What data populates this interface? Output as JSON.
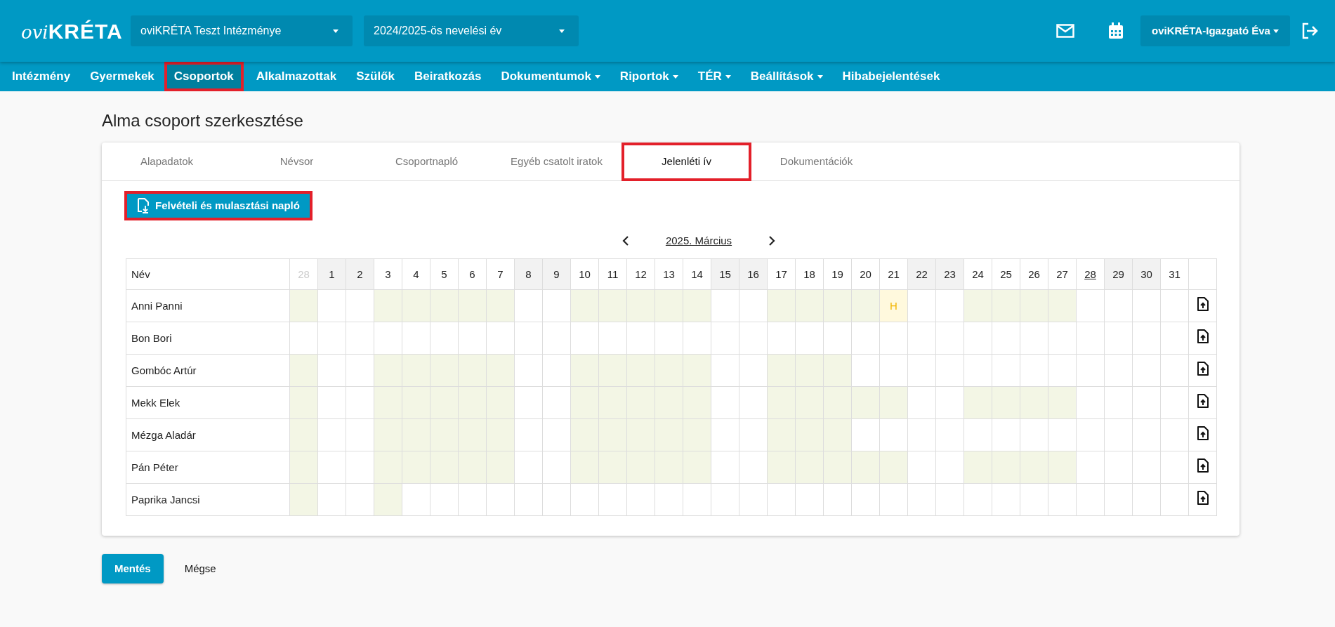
{
  "header": {
    "logo_script": "ovi",
    "logo_name": "KRÉTA",
    "institution": "oviKRÉTA Teszt Intézménye",
    "school_year": "2024/2025-ös nevelési év",
    "user": "oviKRÉTA-Igazgató Éva"
  },
  "nav": [
    {
      "label": "Intézmény",
      "dropdown": false,
      "selected": false,
      "highlighted": false
    },
    {
      "label": "Gyermekek",
      "dropdown": false,
      "selected": false,
      "highlighted": false
    },
    {
      "label": "Csoportok",
      "dropdown": false,
      "selected": true,
      "highlighted": true
    },
    {
      "label": "Alkalmazottak",
      "dropdown": false,
      "selected": false,
      "highlighted": false
    },
    {
      "label": "Szülők",
      "dropdown": false,
      "selected": false,
      "highlighted": false
    },
    {
      "label": "Beiratkozás",
      "dropdown": false,
      "selected": false,
      "highlighted": false
    },
    {
      "label": "Dokumentumok",
      "dropdown": true,
      "selected": false,
      "highlighted": false
    },
    {
      "label": "Riportok",
      "dropdown": true,
      "selected": false,
      "highlighted": false
    },
    {
      "label": "TÉR",
      "dropdown": true,
      "selected": false,
      "highlighted": false
    },
    {
      "label": "Beállítások",
      "dropdown": true,
      "selected": false,
      "highlighted": false
    },
    {
      "label": "Hibabejelentések",
      "dropdown": false,
      "selected": false,
      "highlighted": false
    }
  ],
  "page_title": "Alma csoport szerkesztése",
  "tabs": [
    {
      "label": "Alapadatok",
      "selected": false,
      "highlighted": false
    },
    {
      "label": "Névsor",
      "selected": false,
      "highlighted": false
    },
    {
      "label": "Csoportnapló",
      "selected": false,
      "highlighted": false
    },
    {
      "label": "Egyéb csatolt iratok",
      "selected": false,
      "highlighted": false
    },
    {
      "label": "Jelenléti ív",
      "selected": true,
      "highlighted": true
    },
    {
      "label": "Dokumentációk",
      "selected": false,
      "highlighted": false
    }
  ],
  "download_button": {
    "label": "Felvételi és mulasztási napló",
    "highlighted": true
  },
  "month": "2025. Március",
  "table": {
    "name_header": "Név",
    "days": [
      {
        "label": "28",
        "other_month": true,
        "weekend": false,
        "today": false
      },
      {
        "label": "1",
        "other_month": false,
        "weekend": true,
        "today": false
      },
      {
        "label": "2",
        "other_month": false,
        "weekend": true,
        "today": false
      },
      {
        "label": "3",
        "other_month": false,
        "weekend": false,
        "today": false
      },
      {
        "label": "4",
        "other_month": false,
        "weekend": false,
        "today": false
      },
      {
        "label": "5",
        "other_month": false,
        "weekend": false,
        "today": false
      },
      {
        "label": "6",
        "other_month": false,
        "weekend": false,
        "today": false
      },
      {
        "label": "7",
        "other_month": false,
        "weekend": false,
        "today": false
      },
      {
        "label": "8",
        "other_month": false,
        "weekend": true,
        "today": false
      },
      {
        "label": "9",
        "other_month": false,
        "weekend": true,
        "today": false
      },
      {
        "label": "10",
        "other_month": false,
        "weekend": false,
        "today": false
      },
      {
        "label": "11",
        "other_month": false,
        "weekend": false,
        "today": false
      },
      {
        "label": "12",
        "other_month": false,
        "weekend": false,
        "today": false
      },
      {
        "label": "13",
        "other_month": false,
        "weekend": false,
        "today": false
      },
      {
        "label": "14",
        "other_month": false,
        "weekend": false,
        "today": false
      },
      {
        "label": "15",
        "other_month": false,
        "weekend": true,
        "today": false
      },
      {
        "label": "16",
        "other_month": false,
        "weekend": true,
        "today": false
      },
      {
        "label": "17",
        "other_month": false,
        "weekend": false,
        "today": false
      },
      {
        "label": "18",
        "other_month": false,
        "weekend": false,
        "today": false
      },
      {
        "label": "19",
        "other_month": false,
        "weekend": false,
        "today": false
      },
      {
        "label": "20",
        "other_month": false,
        "weekend": false,
        "today": false
      },
      {
        "label": "21",
        "other_month": false,
        "weekend": false,
        "today": false
      },
      {
        "label": "22",
        "other_month": false,
        "weekend": true,
        "today": false
      },
      {
        "label": "23",
        "other_month": false,
        "weekend": true,
        "today": false
      },
      {
        "label": "24",
        "other_month": false,
        "weekend": false,
        "today": false
      },
      {
        "label": "25",
        "other_month": false,
        "weekend": false,
        "today": false
      },
      {
        "label": "26",
        "other_month": false,
        "weekend": false,
        "today": false
      },
      {
        "label": "27",
        "other_month": false,
        "weekend": false,
        "today": false
      },
      {
        "label": "28",
        "other_month": false,
        "weekend": false,
        "today": true
      },
      {
        "label": "29",
        "other_month": false,
        "weekend": true,
        "today": false
      },
      {
        "label": "30",
        "other_month": false,
        "weekend": true,
        "today": false
      },
      {
        "label": "31",
        "other_month": false,
        "weekend": false,
        "today": false
      }
    ],
    "rows": [
      {
        "name": "Anni Panni",
        "cells": [
          {
            "kind": "present"
          },
          {
            "kind": "empty"
          },
          {
            "kind": "empty"
          },
          {
            "kind": "present"
          },
          {
            "kind": "present"
          },
          {
            "kind": "present"
          },
          {
            "kind": "present"
          },
          {
            "kind": "present"
          },
          {
            "kind": "empty"
          },
          {
            "kind": "empty"
          },
          {
            "kind": "present"
          },
          {
            "kind": "present"
          },
          {
            "kind": "present"
          },
          {
            "kind": "present"
          },
          {
            "kind": "present"
          },
          {
            "kind": "empty"
          },
          {
            "kind": "empty"
          },
          {
            "kind": "present"
          },
          {
            "kind": "present"
          },
          {
            "kind": "present"
          },
          {
            "kind": "present"
          },
          {
            "kind": "absent",
            "text": "H"
          },
          {
            "kind": "empty"
          },
          {
            "kind": "empty"
          },
          {
            "kind": "present"
          },
          {
            "kind": "present"
          },
          {
            "kind": "present"
          },
          {
            "kind": "present"
          },
          {
            "kind": "empty"
          },
          {
            "kind": "empty"
          },
          {
            "kind": "empty"
          },
          {
            "kind": "empty"
          }
        ]
      },
      {
        "name": "Bon Bori",
        "cells": [
          {
            "kind": "empty"
          },
          {
            "kind": "empty"
          },
          {
            "kind": "empty"
          },
          {
            "kind": "empty"
          },
          {
            "kind": "empty"
          },
          {
            "kind": "empty"
          },
          {
            "kind": "empty"
          },
          {
            "kind": "empty"
          },
          {
            "kind": "empty"
          },
          {
            "kind": "empty"
          },
          {
            "kind": "empty"
          },
          {
            "kind": "empty"
          },
          {
            "kind": "empty"
          },
          {
            "kind": "empty"
          },
          {
            "kind": "empty"
          },
          {
            "kind": "empty"
          },
          {
            "kind": "empty"
          },
          {
            "kind": "empty"
          },
          {
            "kind": "empty"
          },
          {
            "kind": "empty"
          },
          {
            "kind": "empty"
          },
          {
            "kind": "empty"
          },
          {
            "kind": "empty"
          },
          {
            "kind": "empty"
          },
          {
            "kind": "empty"
          },
          {
            "kind": "empty"
          },
          {
            "kind": "empty"
          },
          {
            "kind": "empty"
          },
          {
            "kind": "empty"
          },
          {
            "kind": "empty"
          },
          {
            "kind": "empty"
          },
          {
            "kind": "empty"
          }
        ]
      },
      {
        "name": "Gombóc Artúr",
        "cells": [
          {
            "kind": "present"
          },
          {
            "kind": "empty"
          },
          {
            "kind": "empty"
          },
          {
            "kind": "present"
          },
          {
            "kind": "present"
          },
          {
            "kind": "present"
          },
          {
            "kind": "present"
          },
          {
            "kind": "present"
          },
          {
            "kind": "empty"
          },
          {
            "kind": "empty"
          },
          {
            "kind": "present"
          },
          {
            "kind": "present"
          },
          {
            "kind": "present"
          },
          {
            "kind": "present"
          },
          {
            "kind": "present"
          },
          {
            "kind": "empty"
          },
          {
            "kind": "empty"
          },
          {
            "kind": "present"
          },
          {
            "kind": "present"
          },
          {
            "kind": "present"
          },
          {
            "kind": "empty"
          },
          {
            "kind": "empty"
          },
          {
            "kind": "empty"
          },
          {
            "kind": "empty"
          },
          {
            "kind": "empty"
          },
          {
            "kind": "empty"
          },
          {
            "kind": "empty"
          },
          {
            "kind": "empty"
          },
          {
            "kind": "empty"
          },
          {
            "kind": "empty"
          },
          {
            "kind": "empty"
          },
          {
            "kind": "empty"
          }
        ]
      },
      {
        "name": "Mekk Elek",
        "cells": [
          {
            "kind": "present"
          },
          {
            "kind": "empty"
          },
          {
            "kind": "empty"
          },
          {
            "kind": "present"
          },
          {
            "kind": "present"
          },
          {
            "kind": "present"
          },
          {
            "kind": "present"
          },
          {
            "kind": "present"
          },
          {
            "kind": "empty"
          },
          {
            "kind": "empty"
          },
          {
            "kind": "present"
          },
          {
            "kind": "present"
          },
          {
            "kind": "present"
          },
          {
            "kind": "present"
          },
          {
            "kind": "present"
          },
          {
            "kind": "empty"
          },
          {
            "kind": "empty"
          },
          {
            "kind": "present"
          },
          {
            "kind": "present"
          },
          {
            "kind": "present"
          },
          {
            "kind": "present"
          },
          {
            "kind": "present"
          },
          {
            "kind": "empty"
          },
          {
            "kind": "empty"
          },
          {
            "kind": "present"
          },
          {
            "kind": "present"
          },
          {
            "kind": "present"
          },
          {
            "kind": "present"
          },
          {
            "kind": "empty"
          },
          {
            "kind": "empty"
          },
          {
            "kind": "empty"
          },
          {
            "kind": "empty"
          }
        ]
      },
      {
        "name": "Mézga Aladár",
        "cells": [
          {
            "kind": "present"
          },
          {
            "kind": "empty"
          },
          {
            "kind": "empty"
          },
          {
            "kind": "present"
          },
          {
            "kind": "present"
          },
          {
            "kind": "present"
          },
          {
            "kind": "present"
          },
          {
            "kind": "present"
          },
          {
            "kind": "empty"
          },
          {
            "kind": "empty"
          },
          {
            "kind": "present"
          },
          {
            "kind": "present"
          },
          {
            "kind": "present"
          },
          {
            "kind": "present"
          },
          {
            "kind": "present"
          },
          {
            "kind": "empty"
          },
          {
            "kind": "empty"
          },
          {
            "kind": "present"
          },
          {
            "kind": "present"
          },
          {
            "kind": "present"
          },
          {
            "kind": "empty"
          },
          {
            "kind": "empty"
          },
          {
            "kind": "empty"
          },
          {
            "kind": "empty"
          },
          {
            "kind": "empty"
          },
          {
            "kind": "empty"
          },
          {
            "kind": "empty"
          },
          {
            "kind": "empty"
          },
          {
            "kind": "empty"
          },
          {
            "kind": "empty"
          },
          {
            "kind": "empty"
          },
          {
            "kind": "empty"
          }
        ]
      },
      {
        "name": "Pán Péter",
        "cells": [
          {
            "kind": "present"
          },
          {
            "kind": "empty"
          },
          {
            "kind": "empty"
          },
          {
            "kind": "present"
          },
          {
            "kind": "present"
          },
          {
            "kind": "present"
          },
          {
            "kind": "present"
          },
          {
            "kind": "present"
          },
          {
            "kind": "empty"
          },
          {
            "kind": "empty"
          },
          {
            "kind": "present"
          },
          {
            "kind": "present"
          },
          {
            "kind": "present"
          },
          {
            "kind": "present"
          },
          {
            "kind": "present"
          },
          {
            "kind": "empty"
          },
          {
            "kind": "empty"
          },
          {
            "kind": "present"
          },
          {
            "kind": "present"
          },
          {
            "kind": "present"
          },
          {
            "kind": "present"
          },
          {
            "kind": "present"
          },
          {
            "kind": "empty"
          },
          {
            "kind": "empty"
          },
          {
            "kind": "present"
          },
          {
            "kind": "present"
          },
          {
            "kind": "present"
          },
          {
            "kind": "present"
          },
          {
            "kind": "empty"
          },
          {
            "kind": "empty"
          },
          {
            "kind": "empty"
          },
          {
            "kind": "empty"
          }
        ]
      },
      {
        "name": "Paprika Jancsi",
        "cells": [
          {
            "kind": "present"
          },
          {
            "kind": "empty"
          },
          {
            "kind": "empty"
          },
          {
            "kind": "present"
          },
          {
            "kind": "empty"
          },
          {
            "kind": "empty"
          },
          {
            "kind": "empty"
          },
          {
            "kind": "empty"
          },
          {
            "kind": "empty"
          },
          {
            "kind": "empty"
          },
          {
            "kind": "empty"
          },
          {
            "kind": "empty"
          },
          {
            "kind": "empty"
          },
          {
            "kind": "empty"
          },
          {
            "kind": "empty"
          },
          {
            "kind": "empty"
          },
          {
            "kind": "empty"
          },
          {
            "kind": "empty"
          },
          {
            "kind": "empty"
          },
          {
            "kind": "empty"
          },
          {
            "kind": "empty"
          },
          {
            "kind": "empty"
          },
          {
            "kind": "empty"
          },
          {
            "kind": "empty"
          },
          {
            "kind": "empty"
          },
          {
            "kind": "empty"
          },
          {
            "kind": "empty"
          },
          {
            "kind": "empty"
          },
          {
            "kind": "empty"
          },
          {
            "kind": "empty"
          },
          {
            "kind": "empty"
          },
          {
            "kind": "empty"
          }
        ]
      }
    ]
  },
  "footer_buttons": [
    {
      "label": "Mentés",
      "kind": "primary"
    },
    {
      "label": "Mégse",
      "kind": "plain"
    }
  ]
}
